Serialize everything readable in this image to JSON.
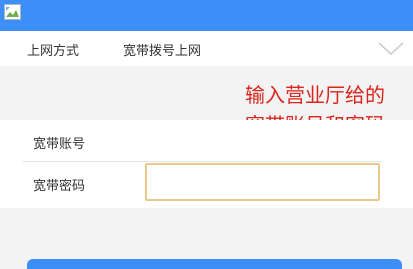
{
  "form": {
    "method_label": "上网方式",
    "method_value": "宽带拨号上网",
    "account_label": "宽带账号",
    "password_label": "宽带密码",
    "password_value": ""
  },
  "annotation": {
    "line1": "输入营业厅给的",
    "line2": "宽带账号和密码",
    "color": "#d9261c"
  },
  "colors": {
    "header": "#3e8ef7",
    "input_border": "#e8c98a",
    "background_gray": "#f3f3f3"
  },
  "icons": {
    "header": "broken-image-icon",
    "dropdown": "chevron-down-icon"
  }
}
